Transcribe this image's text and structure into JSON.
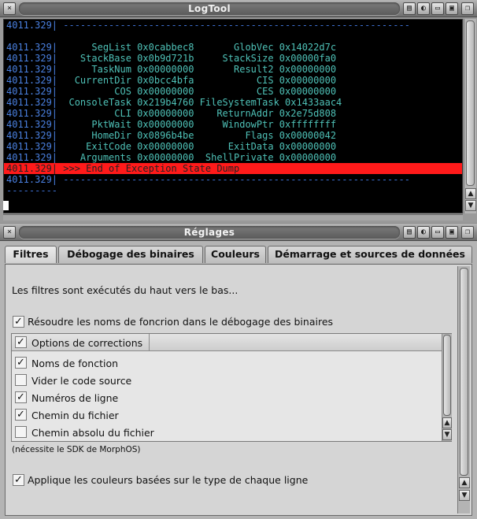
{
  "logtool": {
    "title": "LogTool",
    "lines": [
      {
        "prefix": "4011.329|",
        "text": " -------------------------------------------------------------",
        "kind": "dash"
      },
      {
        "prefix": "",
        "text": "",
        "kind": "normal"
      },
      {
        "prefix": "4011.329|",
        "text": "      SegList 0x0cabbec8       GlobVec 0x14022d7c",
        "kind": "normal"
      },
      {
        "prefix": "4011.329|",
        "text": "    StackBase 0x0b9d721b     StackSize 0x00000fa0",
        "kind": "normal"
      },
      {
        "prefix": "4011.329|",
        "text": "      TaskNum 0x00000000       Result2 0x00000000",
        "kind": "normal"
      },
      {
        "prefix": "4011.329|",
        "text": "   CurrentDir 0x0bcc4bfa           CIS 0x00000000",
        "kind": "normal"
      },
      {
        "prefix": "4011.329|",
        "text": "          COS 0x00000000           CES 0x00000000",
        "kind": "normal"
      },
      {
        "prefix": "4011.329|",
        "text": "  ConsoleTask 0x219b4760 FileSystemTask 0x1433aac4",
        "kind": "normal"
      },
      {
        "prefix": "4011.329|",
        "text": "          CLI 0x00000000    ReturnAddr 0x2e75d808",
        "kind": "normal"
      },
      {
        "prefix": "4011.329|",
        "text": "      PktWait 0x00000000     WindowPtr 0xffffffff",
        "kind": "normal"
      },
      {
        "prefix": "4011.329|",
        "text": "      HomeDir 0x0896b4be         Flags 0x00000042",
        "kind": "normal"
      },
      {
        "prefix": "4011.329|",
        "text": "     ExitCode 0x00000000      ExitData 0x00000000",
        "kind": "normal"
      },
      {
        "prefix": "4011.329|",
        "text": "    Arguments 0x00000000  ShellPrivate 0x00000000",
        "kind": "normal"
      },
      {
        "prefix": "4011.329|",
        "text": " >>> End of Exception State Dump",
        "kind": "highlight"
      },
      {
        "prefix": "4011.329|",
        "text": " -------------------------------------------------------------",
        "kind": "dash"
      },
      {
        "prefix": "",
        "text": "---------",
        "kind": "dash"
      }
    ]
  },
  "reglages": {
    "title": "Réglages",
    "tabs": [
      "Filtres",
      "Débogage des binaires",
      "Couleurs",
      "Démarrage et sources de données"
    ],
    "intro": "Les filtres sont exécutés du haut vers le bas...",
    "resolve_label": "Résoudre les noms de foncrion dans le débogage des binaires",
    "resolve_checked": true,
    "list_header": "Options de corrections",
    "list_header_checked": true,
    "options": [
      {
        "label": "Noms de fonction",
        "checked": true
      },
      {
        "label": "Vider le code source",
        "checked": false
      },
      {
        "label": "Numéros de ligne",
        "checked": true
      },
      {
        "label": "Chemin du fichier",
        "checked": true
      },
      {
        "label": "Chemin absolu du fichier",
        "checked": false
      }
    ],
    "sdk_note": "(nécessite le SDK de MorphOS)",
    "colors_label": "Applique les couleurs basées sur le type de chaque ligne",
    "colors_checked": true
  }
}
